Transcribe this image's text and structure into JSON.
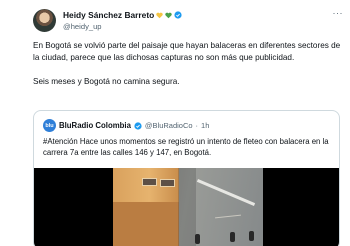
{
  "tweet": {
    "author_name": "Heidy Sánchez Barreto",
    "author_handle": "@heidy_up",
    "heart_colors": [
      "#f5c542",
      "#4aa04a"
    ],
    "verified_color": "#1d9bf0",
    "more_icon": "more-horizontal-icon",
    "text_paragraph_1": "En Bogotá se volvió parte del paisaje que hayan balaceras en diferentes sectores de la ciudad, parece que las dichosas capturas no son más que publicidad.",
    "text_paragraph_2": "Seis meses y Bogotá no camina segura."
  },
  "quoted_tweet": {
    "avatar_text": "blu",
    "author_name": "BluRadio Colombia",
    "author_handle": "@BluRadioCo",
    "separator": "·",
    "time": "1h",
    "text": "#Atención Hace unos momentos se registró un intento de fleteo con balacera en la carrera 7a entre las calles 146 y 147, en Bogotá.",
    "media_type": "video"
  }
}
